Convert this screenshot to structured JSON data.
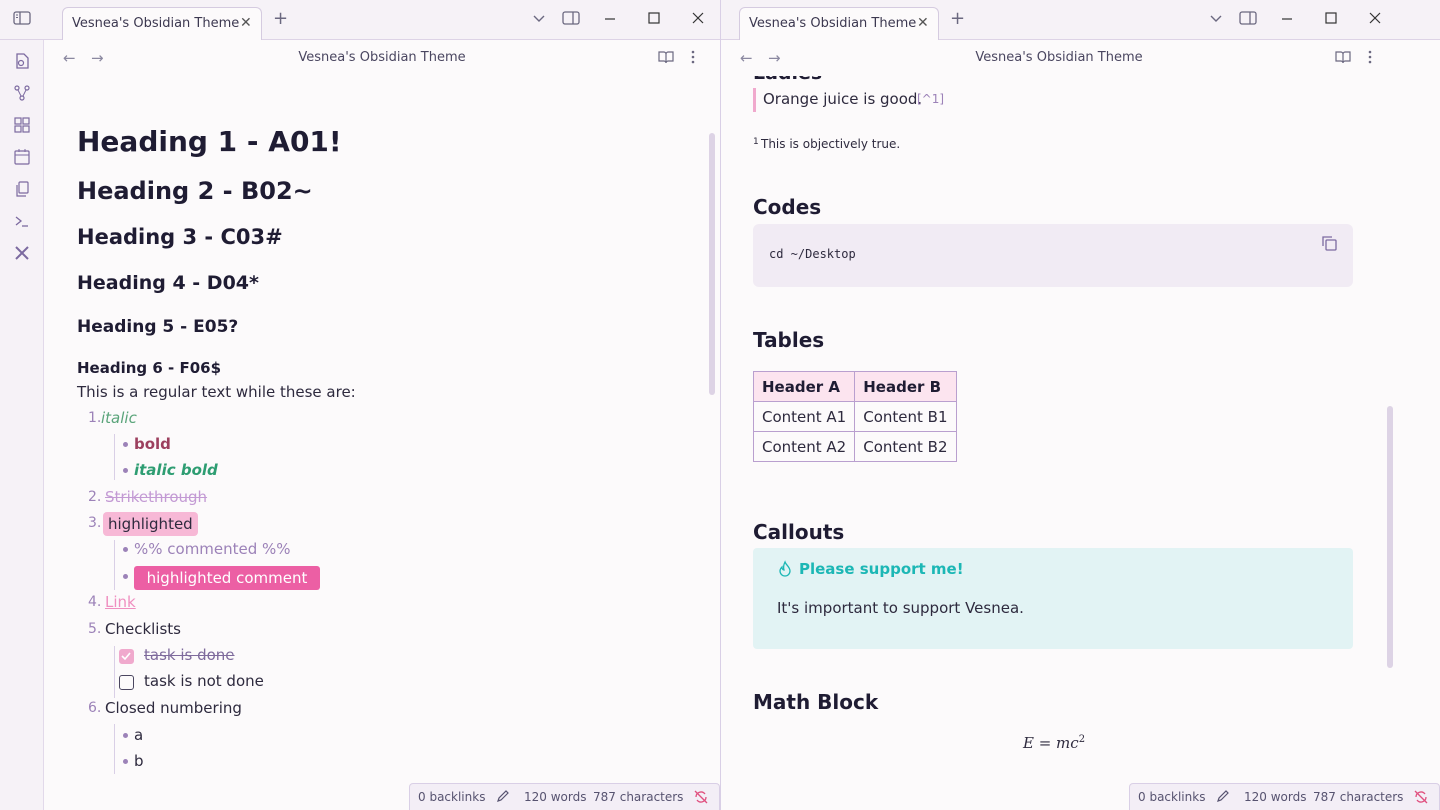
{
  "left_pane": {
    "tab_title": "Vesnea's Obsidian Theme",
    "view_title": "Vesnea's Obsidian Theme",
    "headings": {
      "h1": "Heading 1 - A01!",
      "h2": "Heading 2 - B02~",
      "h3": "Heading 3 - C03#",
      "h4": "Heading 4 - D04*",
      "h5": "Heading 5 - E05?",
      "h6": "Heading 6 - F06$"
    },
    "regular_text": "This is a regular text while these are:",
    "list": {
      "n1": "1.",
      "italic": "italic",
      "bold": "bold",
      "italic_bold": "italic bold",
      "n2": "2.",
      "strikethrough": "Strikethrough",
      "n3": "3.",
      "highlighted": "highlighted",
      "commented": "%% commented %%",
      "highlighted_comment": "highlighted comment",
      "n4": "4.",
      "link": "Link",
      "n5": "5.",
      "checklists": "Checklists",
      "task_done": "task is done",
      "task_not_done": "task is not done",
      "n6": "6.",
      "closed_numbering": "Closed numbering",
      "sub_a": "a",
      "sub_b": "b"
    },
    "status": {
      "backlinks": "0 backlinks",
      "words": "120 words",
      "characters": "787 characters"
    }
  },
  "right_pane": {
    "tab_title": "Vesnea's Obsidian Theme",
    "view_title": "Vesnea's Obsidian Theme",
    "partial_heading": "Ladies",
    "quote_text": "Orange juice is good.",
    "footnote_ref": "[^1]",
    "footnote_num": "1",
    "footnote_text": "This is objectively true.",
    "codes_heading": "Codes",
    "code_text": "cd ~/Desktop",
    "tables_heading": "Tables",
    "table": {
      "headers": [
        "Header A",
        "Header B"
      ],
      "rows": [
        [
          "Content A1",
          "Content B1"
        ],
        [
          "Content A2",
          "Content B2"
        ]
      ]
    },
    "callouts_heading": "Callouts",
    "callout_title": "Please support me!",
    "callout_body": "It's important to support Vesnea.",
    "math_heading": "Math Block",
    "math_expr": "E = mc",
    "math_exp": "2",
    "status": {
      "backlinks": "0 backlinks",
      "words": "120 words",
      "characters": "787 characters"
    }
  },
  "colors": {
    "accent": "#9c82b8",
    "highlight": "#f7b8d6",
    "highlight_comment": "#ec5fa4",
    "italic": "#5aa47a",
    "bold": "#9c3f5e",
    "italic_bold": "#2e9d72",
    "callout_bg": "#e2f3f4",
    "callout_title": "#1cb7b5"
  },
  "icons": [
    "sidebar-toggle-icon",
    "plus-icon",
    "chevron-down-icon",
    "layout-icon",
    "minimize-icon",
    "maximize-icon",
    "close-icon",
    "back-arrow-icon",
    "forward-arrow-icon",
    "book-icon",
    "more-vertical-icon",
    "copy-icon",
    "pencil-icon",
    "sync-off-icon",
    "flame-icon"
  ]
}
